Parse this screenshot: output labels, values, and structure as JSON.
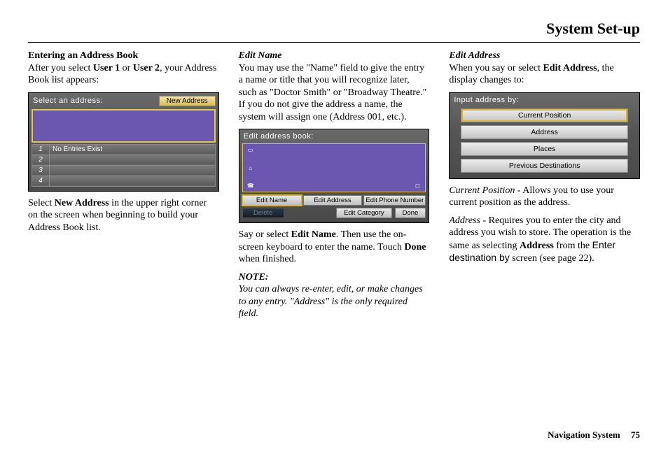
{
  "page_title": "System Set-up",
  "footer": {
    "label": "Navigation System",
    "page": "75"
  },
  "col1": {
    "heading": "Entering an Address Book",
    "p1_a": "After you select ",
    "p1_b1": "User 1",
    "p1_or": " or ",
    "p1_b2": "User 2",
    "p1_c": ", your Address Book list appears:",
    "p2_a": "Select ",
    "p2_b": "New Address",
    "p2_c": " in the upper right corner on the screen when beginning to build your Address Book list.",
    "shot": {
      "title": "Select an address:",
      "new_address_btn": "New Address",
      "rows": [
        "1",
        "2",
        "3",
        "4"
      ],
      "row1_text": "No Entries Exist"
    }
  },
  "col2": {
    "h1": "Edit Name",
    "p1": "You may use the \"Name\" field to give the entry a name or title that you will recognize later, such as \"Doctor Smith\" or \"Broadway Theatre.\" If you do not give the address a name, the system will assign one (Address 001, etc.).",
    "shot": {
      "title": "Edit address book:",
      "btns": [
        "Edit Name",
        "Edit Address",
        "Edit Phone Number"
      ],
      "delete": "Delete",
      "edit_cat": "Edit Category",
      "done": "Done"
    },
    "p2_a": "Say or select ",
    "p2_b": "Edit Name",
    "p2_c": ". Then use the on-screen keyboard to enter the name. Touch ",
    "p2_d": "Done",
    "p2_e": " when finished.",
    "note_label": "NOTE:",
    "note_body": "You can always re-enter, edit, or make changes to any entry. \"Address\" is the only required field."
  },
  "col3": {
    "h1": "Edit Address",
    "p1_a": "When you say or select ",
    "p1_b": "Edit Address",
    "p1_c": ", the display changes to:",
    "shot": {
      "title": "Input address by:",
      "items": [
        "Current Position",
        "Address",
        "Places",
        "Previous Destinations"
      ]
    },
    "p2_label": "Current Position",
    "p2_rest": " - Allows you to use your current position as the address.",
    "p3_label": "Address ",
    "p3_a": "- Requires you to enter the city and address you wish to store. The operation is the same as selecting ",
    "p3_b": "Address",
    "p3_c": " from the ",
    "p3_d": "Enter destination by",
    "p3_e": " screen (see page 22)."
  }
}
